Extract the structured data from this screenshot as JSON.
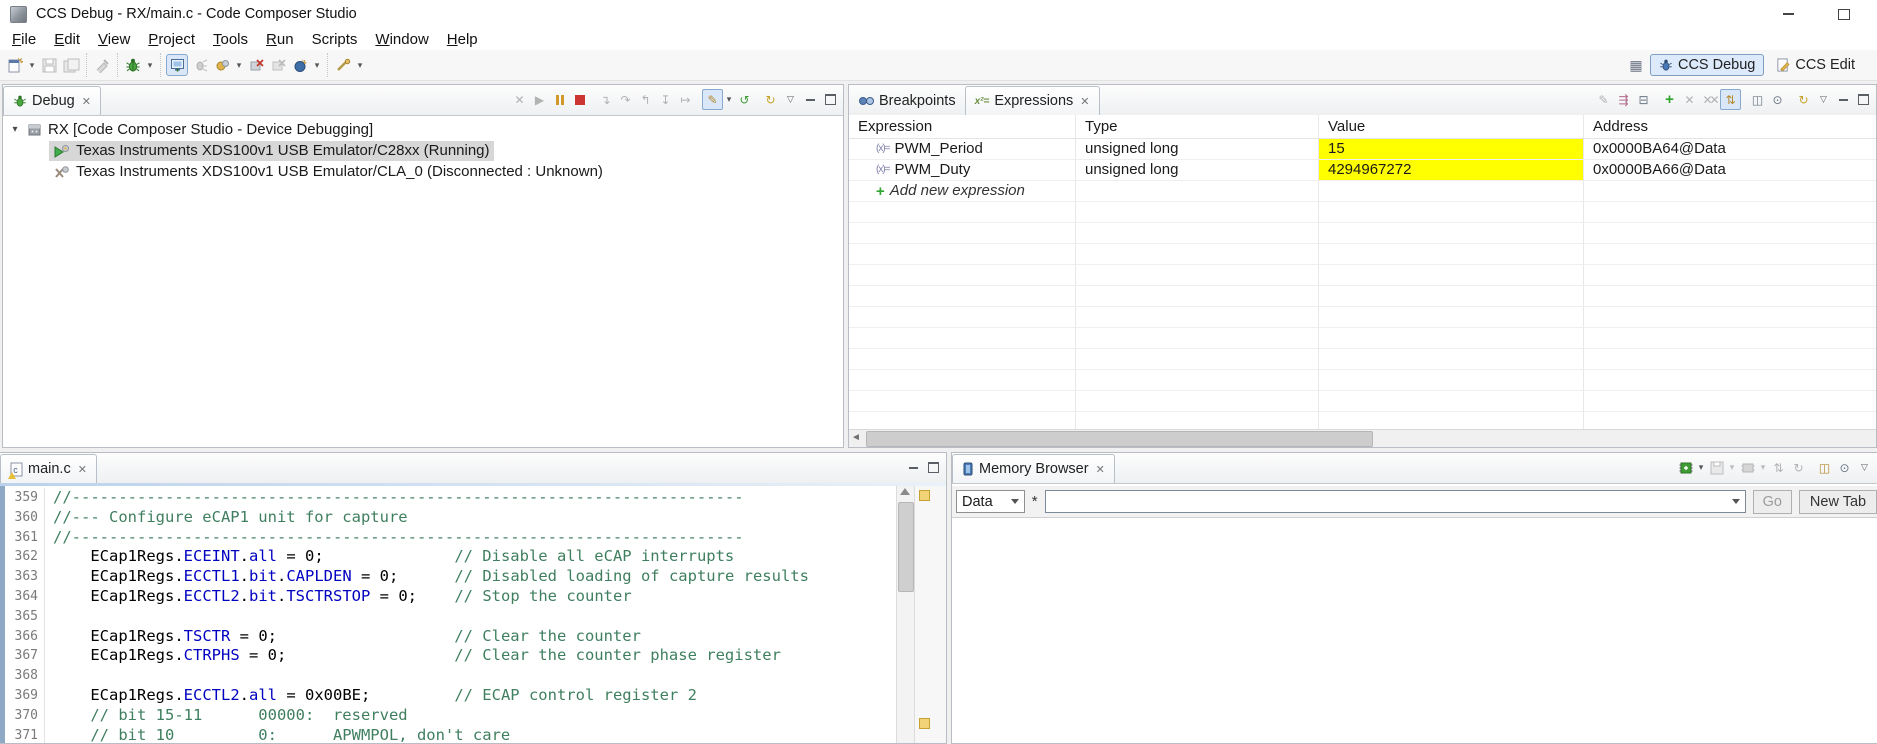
{
  "window": {
    "title": "CCS Debug - RX/main.c - Code Composer Studio"
  },
  "menu": {
    "items": [
      {
        "label": "File",
        "underline": true
      },
      {
        "label": "Edit",
        "underline": true
      },
      {
        "label": "View",
        "underline": true
      },
      {
        "label": "Project",
        "underline": true
      },
      {
        "label": "Tools",
        "underline": true
      },
      {
        "label": "Run",
        "underline": true
      },
      {
        "label": "Scripts",
        "underline": false
      },
      {
        "label": "Window",
        "underline": true
      },
      {
        "label": "Help",
        "underline": true
      }
    ]
  },
  "perspectives": {
    "debug": "CCS Debug",
    "edit": "CCS Edit"
  },
  "debug_panel": {
    "tab": "Debug",
    "tree": [
      {
        "label": "RX [Code Composer Studio - Device Debugging]",
        "level": 0,
        "icon": "ccs-project",
        "expanded": true
      },
      {
        "label": "Texas Instruments XDS100v1 USB Emulator/C28xx (Running)",
        "level": 1,
        "icon": "core-running",
        "selected": true
      },
      {
        "label": "Texas Instruments XDS100v1 USB Emulator/CLA_0 (Disconnected : Unknown)",
        "level": 1,
        "icon": "core-disconnected"
      }
    ]
  },
  "expressions_panel": {
    "tabs": [
      {
        "label": "Breakpoints"
      },
      {
        "label": "Expressions"
      }
    ],
    "columns": [
      "Expression",
      "Type",
      "Value",
      "Address"
    ],
    "rows": [
      {
        "expression": "PWM_Period",
        "type": "unsigned long",
        "value": "15",
        "value_highlight": true,
        "address": "0x0000BA64@Data"
      },
      {
        "expression": "PWM_Duty",
        "type": "unsigned long",
        "value": "4294967272",
        "value_highlight": true,
        "address": "0x0000BA66@Data"
      }
    ],
    "add_row_label": "Add new expression",
    "empty_rows": 11,
    "highlight_color": "#ffff00"
  },
  "editor": {
    "tab": "main.c",
    "lines": [
      {
        "n": 359,
        "text": "//------------------------------------------------------------------------"
      },
      {
        "n": 360,
        "text": "//--- Configure eCAP1 unit for capture"
      },
      {
        "n": 361,
        "text": "//------------------------------------------------------------------------"
      },
      {
        "n": 362,
        "text": "    ECap1Regs.ECEINT.all = 0;              // Disable all eCAP interrupts"
      },
      {
        "n": 363,
        "text": "    ECap1Regs.ECCTL1.bit.CAPLDEN = 0;      // Disabled loading of capture results"
      },
      {
        "n": 364,
        "text": "    ECap1Regs.ECCTL2.bit.TSCTRSTOP = 0;    // Stop the counter"
      },
      {
        "n": 365,
        "text": ""
      },
      {
        "n": 366,
        "text": "    ECap1Regs.TSCTR = 0;                   // Clear the counter"
      },
      {
        "n": 367,
        "text": "    ECap1Regs.CTRPHS = 0;                  // Clear the counter phase register"
      },
      {
        "n": 368,
        "text": ""
      },
      {
        "n": 369,
        "text": "    ECap1Regs.ECCTL2.all = 0x00BE;         // ECAP control register 2"
      },
      {
        "n": 370,
        "text": "    // bit 15-11      00000:  reserved"
      },
      {
        "n": 371,
        "text": "    // bit 10         0:      APWMPOL, don't care"
      }
    ]
  },
  "memory_panel": {
    "tab": "Memory Browser",
    "format_select": "Data",
    "required_marker": "*",
    "address_value": "",
    "go_label": "Go",
    "new_tab_label": "New Tab"
  }
}
